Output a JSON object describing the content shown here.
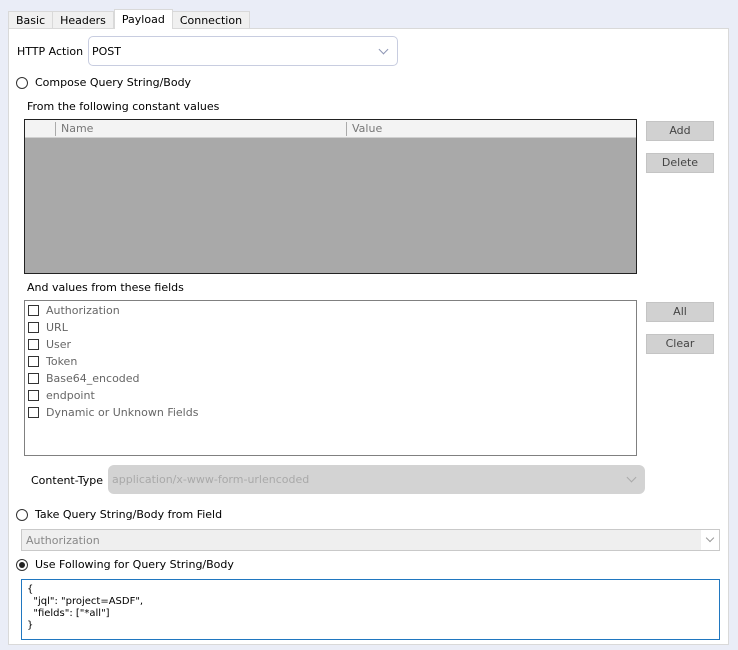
{
  "tabs": [
    {
      "label": "Basic",
      "active": false
    },
    {
      "label": "Headers",
      "active": false
    },
    {
      "label": "Payload",
      "active": true
    },
    {
      "label": "Connection",
      "active": false
    }
  ],
  "http_action": {
    "label": "HTTP Action",
    "value": "POST"
  },
  "compose": {
    "radio_label": "Compose Query String/Body",
    "selected": false,
    "constant_values_label": "From the following constant values",
    "grid_columns": [
      "Name",
      "Value"
    ],
    "add_button": "Add",
    "delete_button": "Delete",
    "fields_label": "And values from these fields",
    "fields": [
      {
        "label": "Authorization",
        "checked": false
      },
      {
        "label": "URL",
        "checked": false
      },
      {
        "label": "User",
        "checked": false
      },
      {
        "label": "Token",
        "checked": false
      },
      {
        "label": "Base64_encoded",
        "checked": false
      },
      {
        "label": "endpoint",
        "checked": false
      },
      {
        "label": "Dynamic or Unknown Fields",
        "checked": false
      }
    ],
    "all_button": "All",
    "clear_button": "Clear",
    "content_type_label": "Content-Type",
    "content_type_value": "application/x-www-form-urlencoded"
  },
  "from_field": {
    "radio_label": "Take Query String/Body from Field",
    "selected": false,
    "field_value": "Authorization"
  },
  "use_following": {
    "radio_label": "Use Following for Query String/Body",
    "selected": true,
    "body": "{\n  \"jql\": \"project=ASDF\",\n  \"fields\": [\"*all\"]\n}"
  }
}
